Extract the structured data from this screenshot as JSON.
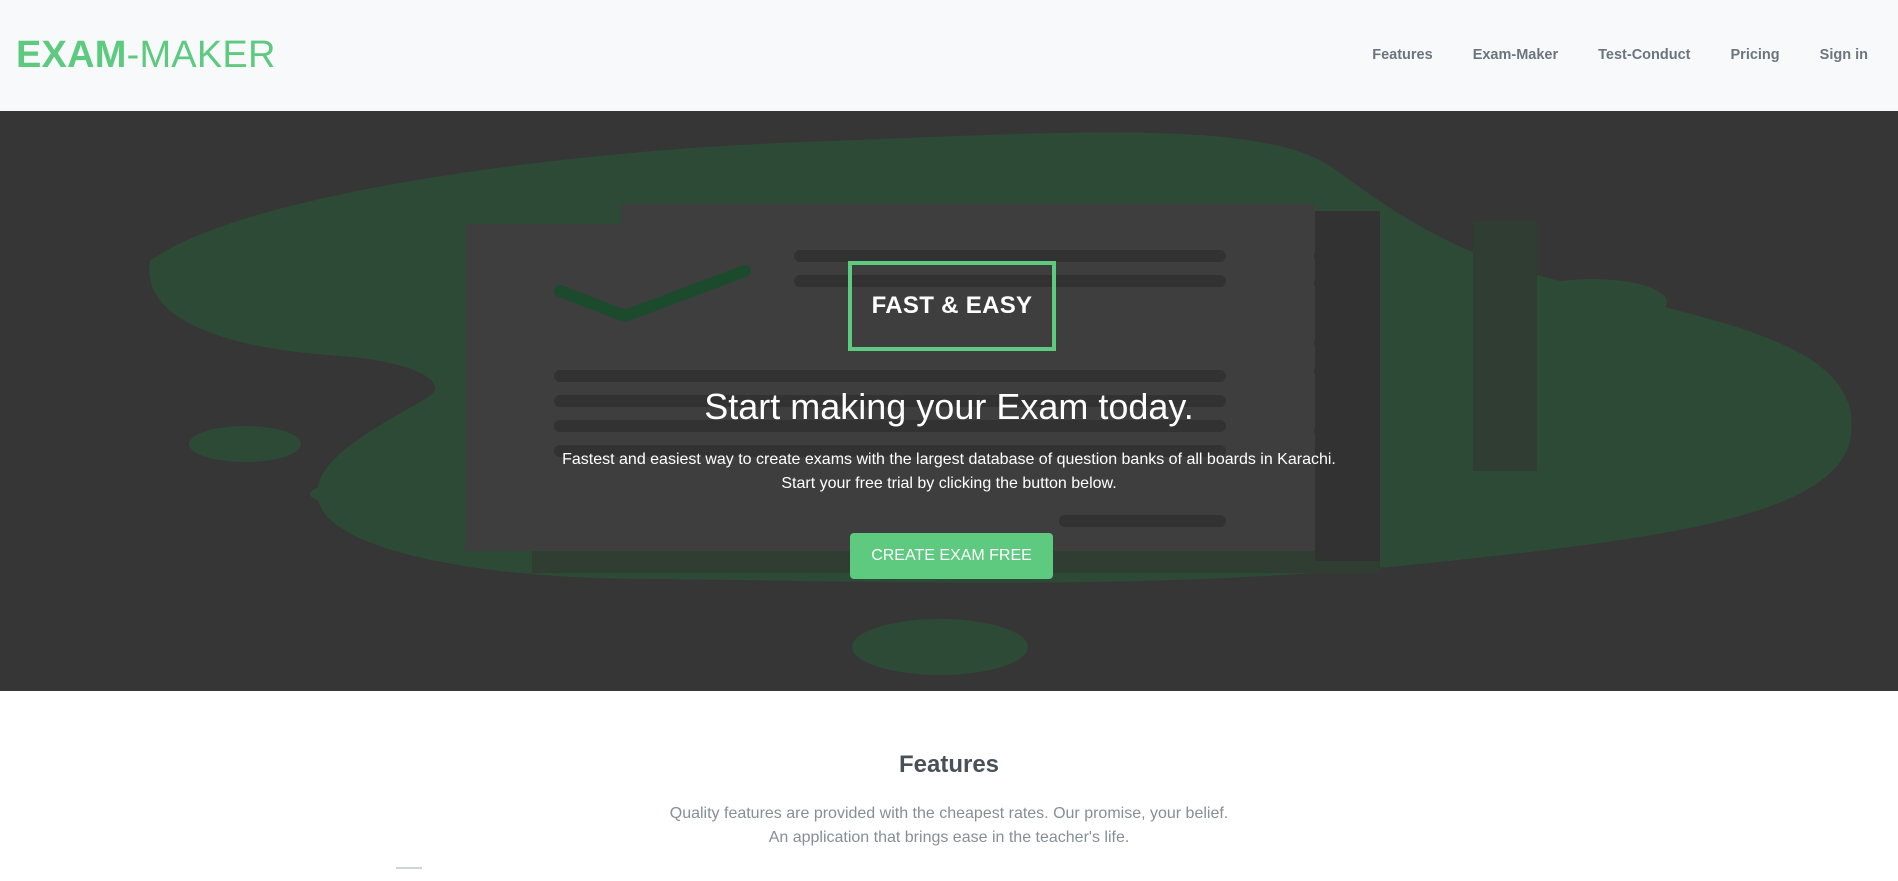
{
  "brand": {
    "bold": "EXAM",
    "rest": "-MAKER"
  },
  "nav": {
    "items": [
      {
        "label": "Features"
      },
      {
        "label": "Exam-Maker"
      },
      {
        "label": "Test-Conduct"
      },
      {
        "label": "Pricing"
      },
      {
        "label": "Sign in"
      }
    ]
  },
  "hero": {
    "badge": "FAST & EASY",
    "headline": "Start making your Exam today.",
    "subtitle_line1": "Fastest and easiest way to create exams with the largest database of question banks of all boards in Karachi.",
    "subtitle_line2": "Start your free trial by clicking the button below.",
    "cta_label": "CREATE EXAM FREE"
  },
  "features": {
    "title": "Features",
    "subtitle_line1": "Quality features are provided with the cheapest rates. Our promise, your belief.",
    "subtitle_line2": "An application that brings ease in the teacher's life."
  },
  "colors": {
    "accent": "#5dca7f",
    "hero_overlay": "#363636",
    "navbar_bg": "#f8f9fa",
    "nav_text": "#6c757d"
  }
}
